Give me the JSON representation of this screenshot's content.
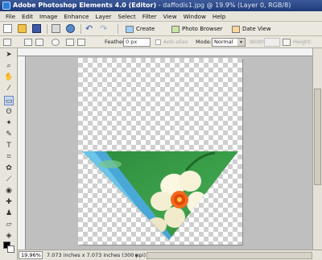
{
  "window": {
    "app_title": "Adobe Photoshop Elements 4.0 (Editor)",
    "doc_title": "daffodis1.jpg @ 19.9% (Layer 0, RGB/8)"
  },
  "menu": [
    "File",
    "Edit",
    "Image",
    "Enhance",
    "Layer",
    "Select",
    "Filter",
    "View",
    "Window",
    "Help"
  ],
  "shortcuts": {
    "create_label": "Create",
    "photo_browser_label": "Photo Browser",
    "date_view_label": "Date View",
    "icons": [
      "new-file-icon",
      "open-icon",
      "save-icon",
      "print-icon",
      "online-print-icon",
      "undo-icon",
      "redo-icon"
    ]
  },
  "options": {
    "feather_label": "Feather:",
    "feather_value": "0 px",
    "antialias_label": "Anti-alias",
    "mode_label": "Mode:",
    "mode_value": "Normal",
    "width_label": "Width:",
    "height_label": "Height:"
  },
  "status": {
    "zoom": "19.96%",
    "doc_info": "7.073 inches x 7.073 inches (300 ppi)",
    "arrow": "▸"
  },
  "colors": {
    "foreground": "#000000",
    "background": "#ffffff",
    "title_bar": "#1f3a78"
  }
}
